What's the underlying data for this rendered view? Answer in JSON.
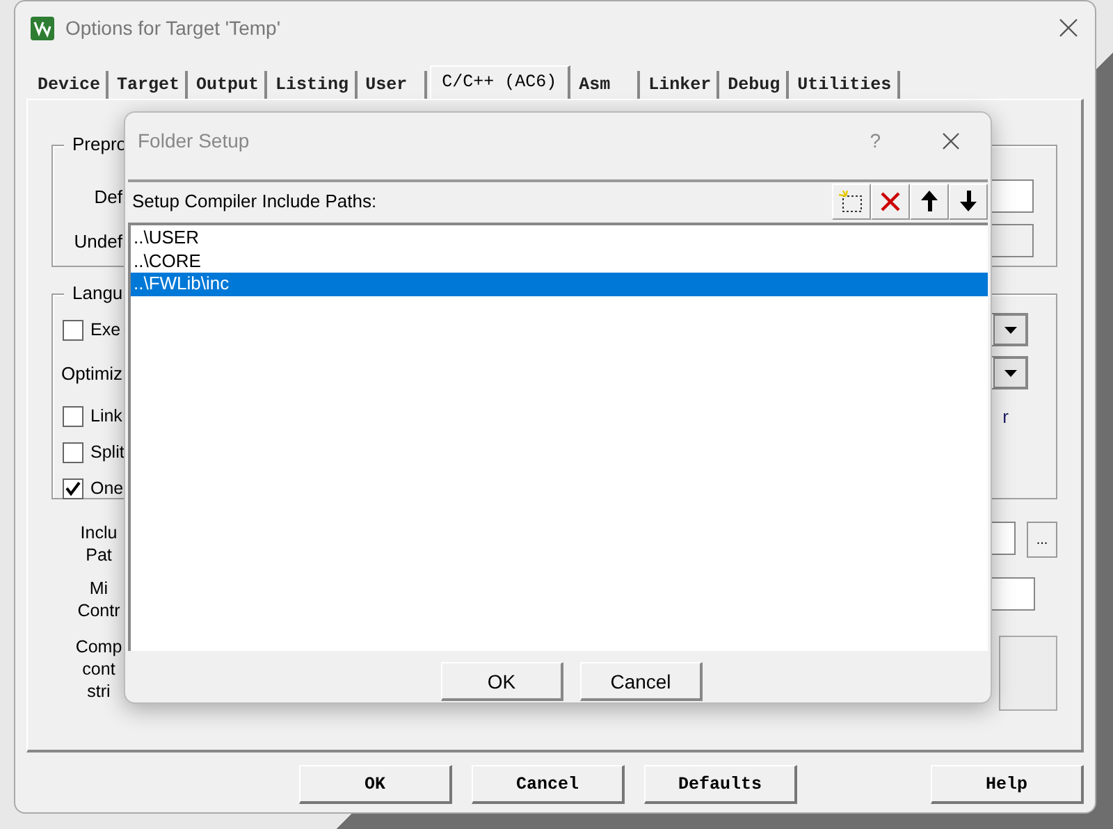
{
  "window": {
    "title": "Options for Target 'Temp'"
  },
  "tabs": [
    {
      "label": "Device",
      "selected": false
    },
    {
      "label": "Target",
      "selected": false
    },
    {
      "label": "Output",
      "selected": false
    },
    {
      "label": "Listing",
      "selected": false
    },
    {
      "label": "User",
      "selected": false
    },
    {
      "label": "C/C++ (AC6)",
      "selected": true
    },
    {
      "label": "Asm",
      "selected": false
    },
    {
      "label": "Linker",
      "selected": false
    },
    {
      "label": "Debug",
      "selected": false
    },
    {
      "label": "Utilities",
      "selected": false
    }
  ],
  "preprocessor_group": {
    "title": "Prepro",
    "fields": [
      {
        "label": "Def"
      },
      {
        "label": "Undef"
      }
    ]
  },
  "language_group": {
    "title": "Langu",
    "rows": [
      {
        "kind": "checkbox",
        "label": "Exe",
        "checked": false,
        "dropdown": true
      },
      {
        "kind": "label",
        "label": "Optimiz",
        "dropdown": true
      },
      {
        "kind": "checkbox",
        "label": "Link",
        "checked": false,
        "right_text": "r"
      },
      {
        "kind": "checkbox",
        "label": "Split",
        "checked": false
      },
      {
        "kind": "checkbox",
        "label": "One",
        "checked": true
      }
    ]
  },
  "lower_rows": [
    {
      "kind": "browse",
      "lines": [
        "Inclu",
        "Pat"
      ],
      "browse_label": "..."
    },
    {
      "kind": "field",
      "lines": [
        "Mi",
        "Contr"
      ]
    },
    {
      "kind": "box",
      "lines": [
        "Comp",
        "cont",
        "stri"
      ]
    }
  ],
  "buttons": [
    "OK",
    "Cancel",
    "Defaults",
    "Help"
  ],
  "dialog": {
    "title": "Folder Setup",
    "help": "?",
    "header": "Setup Compiler Include Paths:",
    "paths": [
      {
        "text": "..\\USER",
        "selected": false
      },
      {
        "text": "..\\CORE",
        "selected": false
      },
      {
        "text": "..\\FWLib\\inc",
        "selected": true
      }
    ],
    "buttons": [
      "OK",
      "Cancel"
    ]
  }
}
